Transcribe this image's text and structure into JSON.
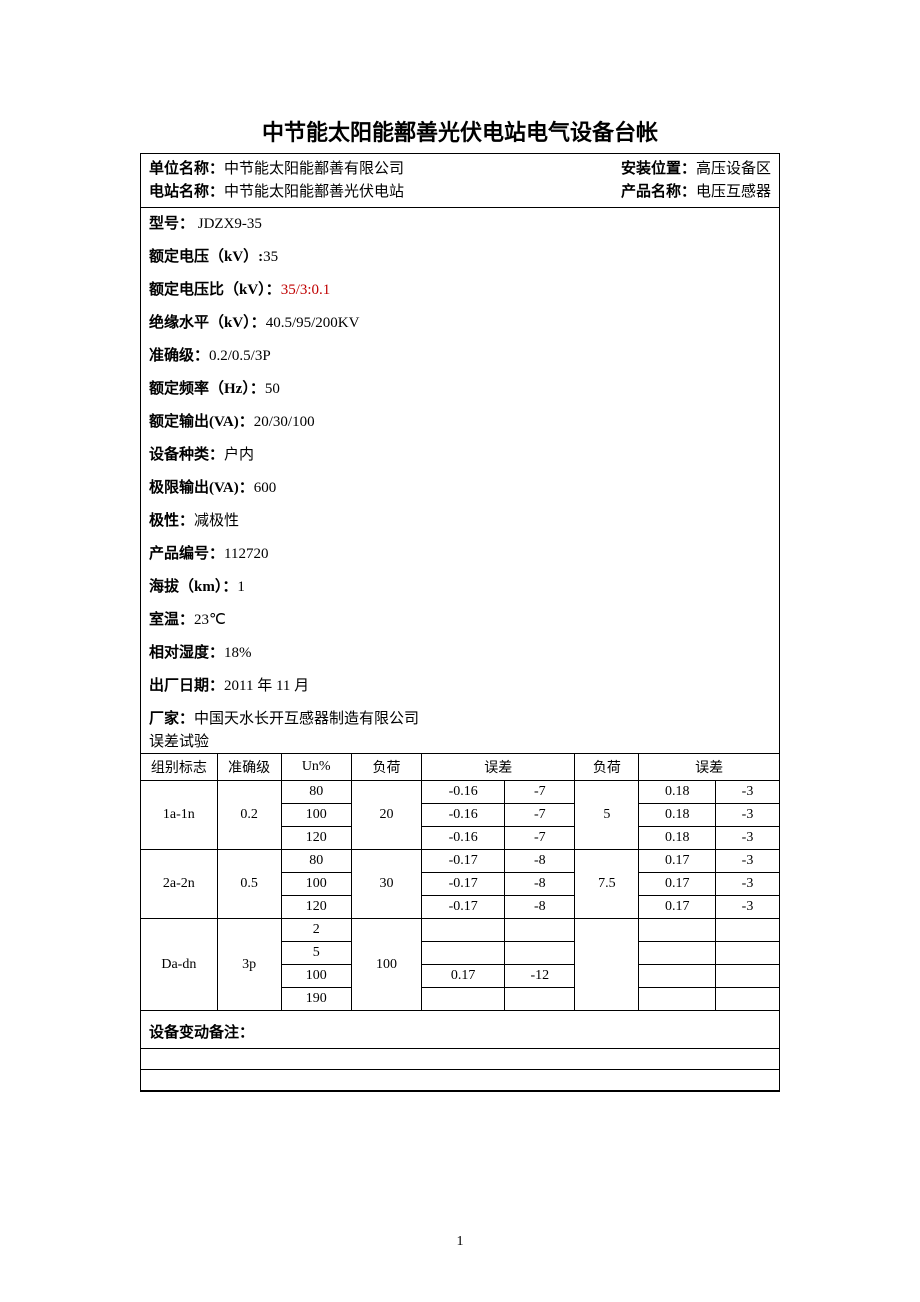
{
  "title": "中节能太阳能鄯善光伏电站电气设备台帐",
  "header": {
    "unit_label": "单位名称：",
    "unit_value": "中节能太阳能鄯善有限公司",
    "install_label": "安装位置：",
    "install_value": "高压设备区",
    "station_label": "电站名称：",
    "station_value": "中节能太阳能鄯善光伏电站",
    "product_label": "产品名称：",
    "product_value": "电压互感器"
  },
  "specs": {
    "model_label": "型号：",
    "model_value": " JDZX9-35",
    "rated_voltage_label": "额定电压（kV）:",
    "rated_voltage_value": "35",
    "rated_ratio_label": "额定电压比（kV）：",
    "rated_ratio_value": "35/3:0.1",
    "insulation_label": "绝缘水平（kV）：",
    "insulation_value": "40.5/95/200KV",
    "accuracy_label": "准确级：",
    "accuracy_value": "0.2/0.5/3P",
    "freq_label": "额定频率（Hz）：",
    "freq_value": "50",
    "rated_output_label": "额定输出(VA)：",
    "rated_output_value": "20/30/100",
    "equip_type_label": "设备种类：",
    "equip_type_value": "户内",
    "max_output_label": "极限输出(VA)：",
    "max_output_value": "600",
    "polarity_label": "极性：",
    "polarity_value": "减极性",
    "product_no_label": "产品编号：",
    "product_no_value": "112720",
    "altitude_label": "海拔（km）：",
    "altitude_value": "1",
    "room_temp_label": "室温：",
    "room_temp_value": "23℃",
    "humidity_label": "相对湿度：",
    "humidity_value": "18%",
    "factory_date_label": "出厂日期：",
    "factory_date_value": "2011 年 11 月",
    "manufacturer_label": "厂家：",
    "manufacturer_value": "中国天水长开互感器制造有限公司"
  },
  "error_test": {
    "title": "误差试验",
    "headers": {
      "group": "组别标志",
      "accuracy": "准确级",
      "un": "Un%",
      "load1": "负荷",
      "err1": "误差",
      "load2": "负荷",
      "err2": "误差"
    },
    "groups": [
      {
        "group": "1a-1n",
        "accuracy": "0.2",
        "load1": "20",
        "load2": "5",
        "rows": [
          {
            "un": "80",
            "e1a": "-0.16",
            "e1b": "-7",
            "e2a": "0.18",
            "e2b": "-3"
          },
          {
            "un": "100",
            "e1a": "-0.16",
            "e1b": "-7",
            "e2a": "0.18",
            "e2b": "-3"
          },
          {
            "un": "120",
            "e1a": "-0.16",
            "e1b": "-7",
            "e2a": "0.18",
            "e2b": "-3"
          }
        ]
      },
      {
        "group": "2a-2n",
        "accuracy": "0.5",
        "load1": "30",
        "load2": "7.5",
        "rows": [
          {
            "un": "80",
            "e1a": "-0.17",
            "e1b": "-8",
            "e2a": "0.17",
            "e2b": "-3"
          },
          {
            "un": "100",
            "e1a": "-0.17",
            "e1b": "-8",
            "e2a": "0.17",
            "e2b": "-3"
          },
          {
            "un": "120",
            "e1a": "-0.17",
            "e1b": "-8",
            "e2a": "0.17",
            "e2b": "-3"
          }
        ]
      },
      {
        "group": "Da-dn",
        "accuracy": "3p",
        "load1": "100",
        "load2": "",
        "rows": [
          {
            "un": "2",
            "e1a": "",
            "e1b": "",
            "e2a": "",
            "e2b": ""
          },
          {
            "un": "5",
            "e1a": "",
            "e1b": "",
            "e2a": "",
            "e2b": ""
          },
          {
            "un": "100",
            "e1a": "0.17",
            "e1b": "-12",
            "e2a": "",
            "e2b": ""
          },
          {
            "un": "190",
            "e1a": "",
            "e1b": "",
            "e2a": "",
            "e2b": ""
          }
        ]
      }
    ]
  },
  "change_note_label": "设备变动备注：",
  "page_number": "1"
}
